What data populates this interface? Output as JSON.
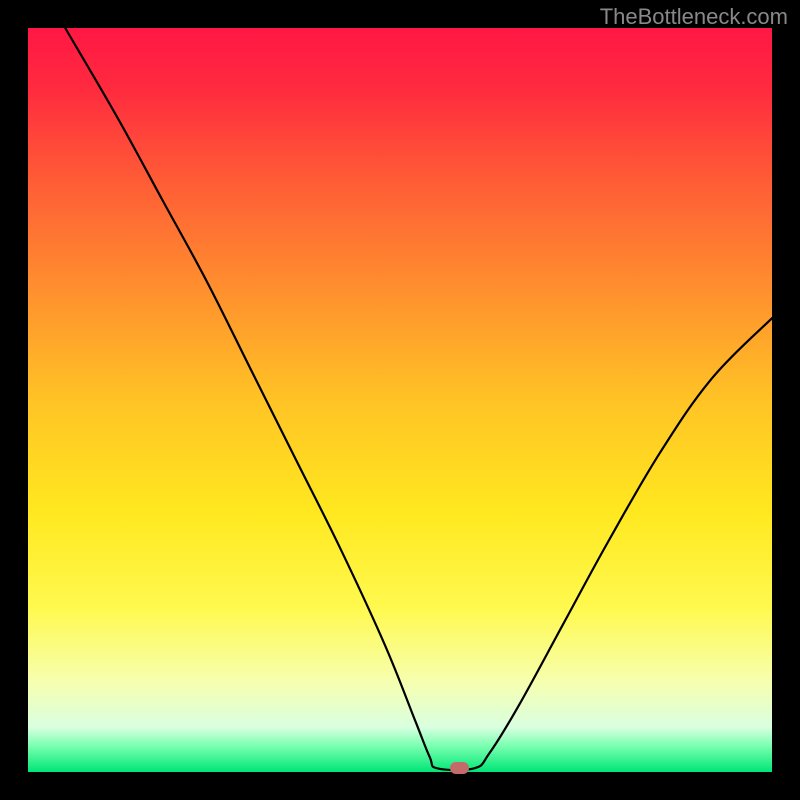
{
  "watermark": "TheBottleneck.com",
  "chart_data": {
    "type": "line",
    "title": "",
    "xlabel": "",
    "ylabel": "",
    "xlim": [
      0,
      100
    ],
    "ylim": [
      0,
      100
    ],
    "gradient_stops": [
      {
        "offset": 0.0,
        "color": "#ff1744"
      },
      {
        "offset": 0.08,
        "color": "#ff2a3f"
      },
      {
        "offset": 0.2,
        "color": "#ff5a36"
      },
      {
        "offset": 0.35,
        "color": "#ff8f2e"
      },
      {
        "offset": 0.5,
        "color": "#ffc325"
      },
      {
        "offset": 0.65,
        "color": "#ffe81f"
      },
      {
        "offset": 0.78,
        "color": "#fff94f"
      },
      {
        "offset": 0.88,
        "color": "#f6ffb0"
      },
      {
        "offset": 0.94,
        "color": "#d9ffe0"
      },
      {
        "offset": 0.965,
        "color": "#7affb0"
      },
      {
        "offset": 1.0,
        "color": "#00e676"
      }
    ],
    "curve": [
      {
        "x": 5.0,
        "y": 100.0
      },
      {
        "x": 12.0,
        "y": 88.0
      },
      {
        "x": 18.0,
        "y": 77.0
      },
      {
        "x": 24.0,
        "y": 66.0
      },
      {
        "x": 30.0,
        "y": 54.0
      },
      {
        "x": 36.0,
        "y": 42.0
      },
      {
        "x": 42.0,
        "y": 30.0
      },
      {
        "x": 48.0,
        "y": 17.0
      },
      {
        "x": 52.0,
        "y": 7.0
      },
      {
        "x": 54.0,
        "y": 2.0
      },
      {
        "x": 55.0,
        "y": 0.5
      },
      {
        "x": 60.0,
        "y": 0.5
      },
      {
        "x": 62.0,
        "y": 2.5
      },
      {
        "x": 66.0,
        "y": 9.0
      },
      {
        "x": 72.0,
        "y": 20.0
      },
      {
        "x": 78.0,
        "y": 31.0
      },
      {
        "x": 85.0,
        "y": 43.0
      },
      {
        "x": 92.0,
        "y": 53.0
      },
      {
        "x": 100.0,
        "y": 61.0
      }
    ],
    "marker": {
      "x": 58.0,
      "y": 0.5,
      "w": 2.6,
      "h": 1.6
    }
  },
  "colors": {
    "stroke": "#000000",
    "marker": "#c46a6a",
    "bg_outer": "#000000"
  }
}
